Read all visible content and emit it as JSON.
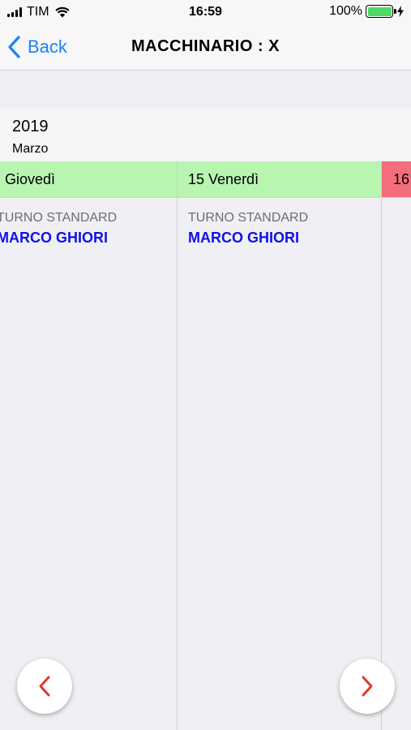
{
  "status_bar": {
    "carrier": "TIM",
    "time": "16:59",
    "battery_percent": "100%",
    "battery_level": 1.0,
    "battery_color": "#4cd964"
  },
  "nav": {
    "back_label": "Back",
    "title": "MACCHINARIO : X"
  },
  "date_header": {
    "year": "2019",
    "month": "Marzo"
  },
  "days": [
    {
      "label": "Giovedì",
      "status_color": "#b8f5b0",
      "shift": "TURNO STANDARD",
      "operator": "MARCO GHIORI"
    },
    {
      "label": "15 Venerdì",
      "status_color": "#b8f5b0",
      "shift": "TURNO STANDARD",
      "operator": "MARCO GHIORI"
    },
    {
      "label": "16",
      "status_color": "#f46d7d"
    }
  ],
  "buttons": {
    "prev_icon": "chevron-left-icon",
    "next_icon": "chevron-right-icon",
    "icon_color": "#e8332a"
  }
}
